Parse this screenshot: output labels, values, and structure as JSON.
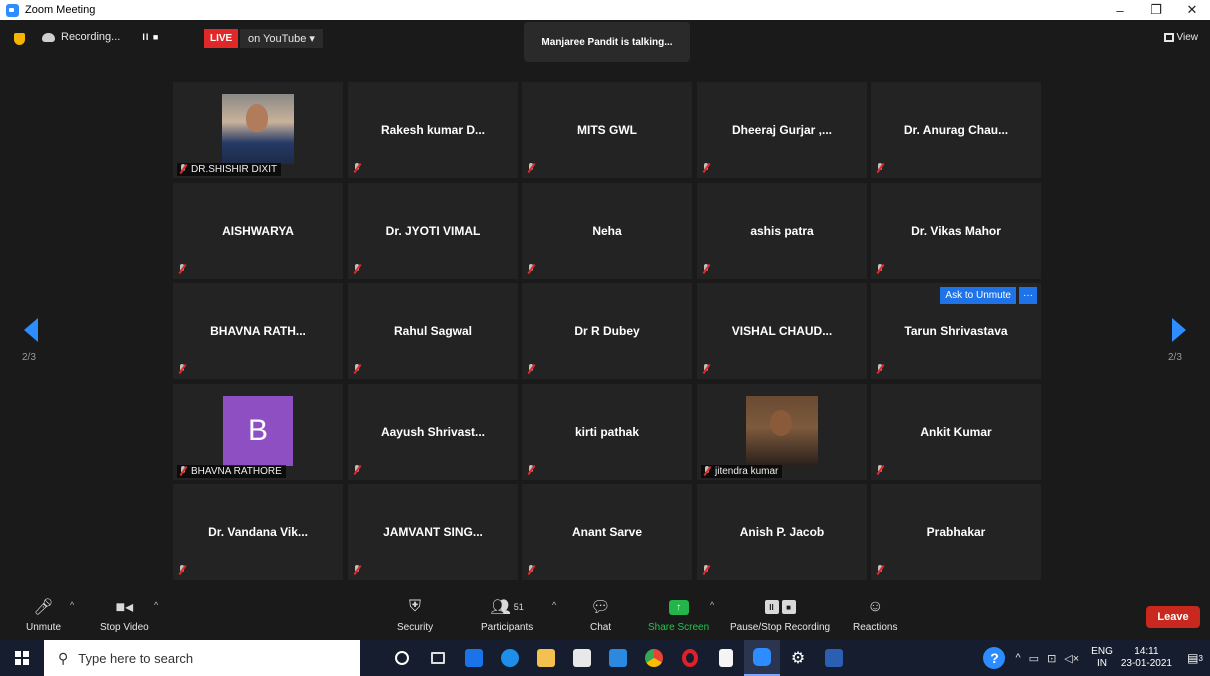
{
  "window": {
    "title": "Zoom Meeting",
    "minimize": "–",
    "maximize": "❐",
    "close": "✕"
  },
  "topbar": {
    "recording_label": "Recording...",
    "pause_stop": "II ■",
    "live_label": "LIVE",
    "youtube_label": "on YouTube ▾",
    "talking": "Manjaree Pandit is talking...",
    "view_label": "View"
  },
  "nav": {
    "left_page": "2/3",
    "right_page": "2/3"
  },
  "participants": [
    {
      "name": "DR.SHISHIR DIXIT",
      "type": "photo-a"
    },
    {
      "name": "Rakesh kumar D...",
      "type": "name"
    },
    {
      "name": "MITS GWL",
      "type": "name"
    },
    {
      "name": "Dheeraj Gurjar ,...",
      "type": "name"
    },
    {
      "name": "Dr. Anurag Chau...",
      "type": "name"
    },
    {
      "name": "AISHWARYA",
      "type": "name"
    },
    {
      "name": "Dr. JYOTI VIMAL",
      "type": "name"
    },
    {
      "name": "Neha",
      "type": "name"
    },
    {
      "name": "ashis patra",
      "type": "name"
    },
    {
      "name": "Dr. Vikas Mahor",
      "type": "name"
    },
    {
      "name": "BHAVNA RATH...",
      "type": "name"
    },
    {
      "name": "Rahul Sagwal",
      "type": "name"
    },
    {
      "name": "Dr R Dubey",
      "type": "name"
    },
    {
      "name": "VISHAL CHAUD...",
      "type": "name"
    },
    {
      "name": "Tarun Shrivastava",
      "type": "name",
      "ask_unmute": "Ask to Unmute",
      "more": "···"
    },
    {
      "name": "BHAVNA RATHORE",
      "type": "avatar",
      "initial": "B"
    },
    {
      "name": "Aayush Shrivast...",
      "type": "name"
    },
    {
      "name": "kirti pathak",
      "type": "name"
    },
    {
      "name": "jitendra kumar",
      "type": "photo-b"
    },
    {
      "name": "Ankit Kumar",
      "type": "name"
    },
    {
      "name": "Dr. Vandana Vik...",
      "type": "name"
    },
    {
      "name": "JAMVANT SING...",
      "type": "name"
    },
    {
      "name": "Anant Sarve",
      "type": "name"
    },
    {
      "name": "Anish P. Jacob",
      "type": "name"
    },
    {
      "name": "Prabhakar",
      "type": "name"
    }
  ],
  "toolbar": {
    "unmute": "Unmute",
    "stop_video": "Stop Video",
    "security": "Security",
    "participants": "Participants",
    "participants_count": "51",
    "chat": "Chat",
    "share_screen": "Share Screen",
    "pause_stop_recording": "Pause/Stop Recording",
    "reactions": "Reactions",
    "leave": "Leave"
  },
  "taskbar": {
    "search_placeholder": "Type here to search",
    "lang_top": "ENG",
    "lang_bottom": "IN",
    "time": "14:11",
    "date": "23-01-2021",
    "notifications": "3"
  },
  "colors": {
    "accent": "#2d8cff",
    "live": "#e02828",
    "share": "#23b54a",
    "leave": "#c8281e",
    "ask_unmute": "#1e73e8"
  }
}
